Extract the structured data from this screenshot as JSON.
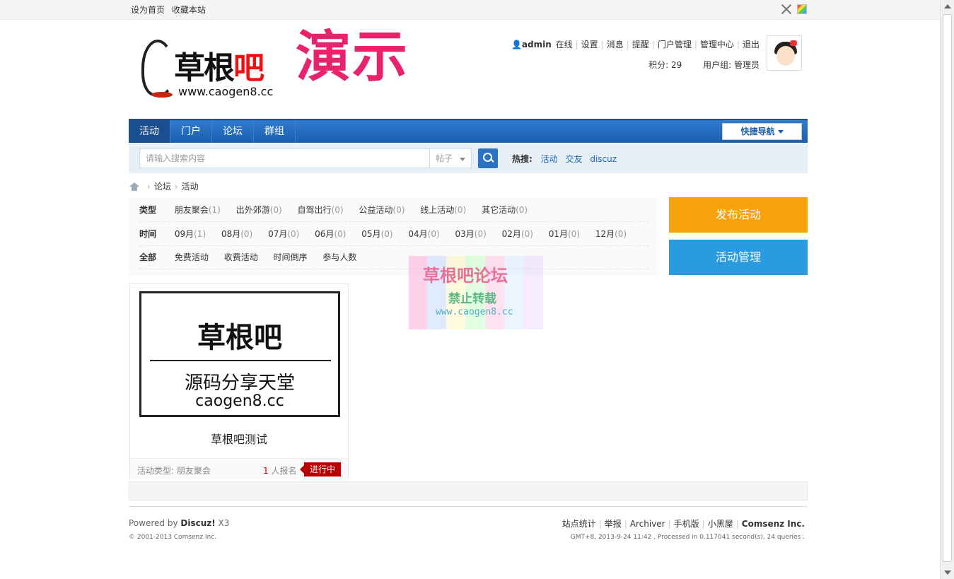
{
  "topbar": {
    "set_home": "设为首页",
    "bookmark": "收藏本站"
  },
  "logo": {
    "name_black": "草根",
    "name_red": "吧",
    "url": "www.caogen8.cc"
  },
  "banner": {
    "text": "演示"
  },
  "user": {
    "name": "admin",
    "online": "在线",
    "links": [
      "设置",
      "消息",
      "提醒",
      "门户管理",
      "管理中心",
      "退出"
    ],
    "points": "积分: 29",
    "group": "用户组: 管理员"
  },
  "nav": {
    "items": [
      "活动",
      "门户",
      "论坛",
      "群组"
    ],
    "quick": "快捷导航"
  },
  "search": {
    "placeholder": "请输入搜索内容",
    "scope": "帖子",
    "hot_label": "热搜:",
    "hot": [
      "活动",
      "交友",
      "discuz"
    ]
  },
  "breadcrumb": [
    "论坛",
    "活动"
  ],
  "filters": {
    "type_label": "类型",
    "types": [
      {
        "name": "朋友聚会",
        "count": "(1)"
      },
      {
        "name": "出外郊游",
        "count": "(0)"
      },
      {
        "name": "自驾出行",
        "count": "(0)"
      },
      {
        "name": "公益活动",
        "count": "(0)"
      },
      {
        "name": "线上活动",
        "count": "(0)"
      },
      {
        "name": "其它活动",
        "count": "(0)"
      }
    ],
    "time_label": "时间",
    "times": [
      {
        "name": "09月",
        "count": "(1)"
      },
      {
        "name": "08月",
        "count": "(0)"
      },
      {
        "name": "07月",
        "count": "(0)"
      },
      {
        "name": "06月",
        "count": "(0)"
      },
      {
        "name": "05月",
        "count": "(0)"
      },
      {
        "name": "04月",
        "count": "(0)"
      },
      {
        "name": "03月",
        "count": "(0)"
      },
      {
        "name": "02月",
        "count": "(0)"
      },
      {
        "name": "01月",
        "count": "(0)"
      },
      {
        "name": "12月",
        "count": "(0)"
      }
    ],
    "all_label": "全部",
    "sorts": [
      "免费活动",
      "收费活动",
      "时间倒序",
      "参与人数"
    ]
  },
  "side": {
    "publish": "发布活动",
    "manage": "活动管理"
  },
  "card": {
    "img_line1": "草根吧",
    "img_line2": "源码分享天堂",
    "img_line3": "caogen8.cc",
    "title": "草根吧测试",
    "type": "活动类型: 朋友聚会",
    "join_count": "1",
    "join_text": " 人报名",
    "status": "进行中"
  },
  "footer": {
    "powered_prefix": "Powered by ",
    "powered_name": "Discuz!",
    "powered_ver": " X3",
    "copyright": "© 2001-2013 Comsenz Inc.",
    "links": [
      "站点统计",
      "举报",
      "Archiver",
      "手机版",
      "小黑屋"
    ],
    "company": "Comsenz Inc.",
    "gmt": "GMT+8, 2013-9-24 11:42 , Processed in 0.117041 second(s), 24 queries ."
  },
  "watermark": {
    "line1": "草根吧论坛",
    "line2": "禁止转载",
    "line3": "www.caogen8.cc"
  },
  "colors": {
    "nav": "#1c5fae",
    "publish": "#f7a20c",
    "manage": "#2b9be0",
    "status": "#b80000",
    "banner": "#e8226c"
  }
}
